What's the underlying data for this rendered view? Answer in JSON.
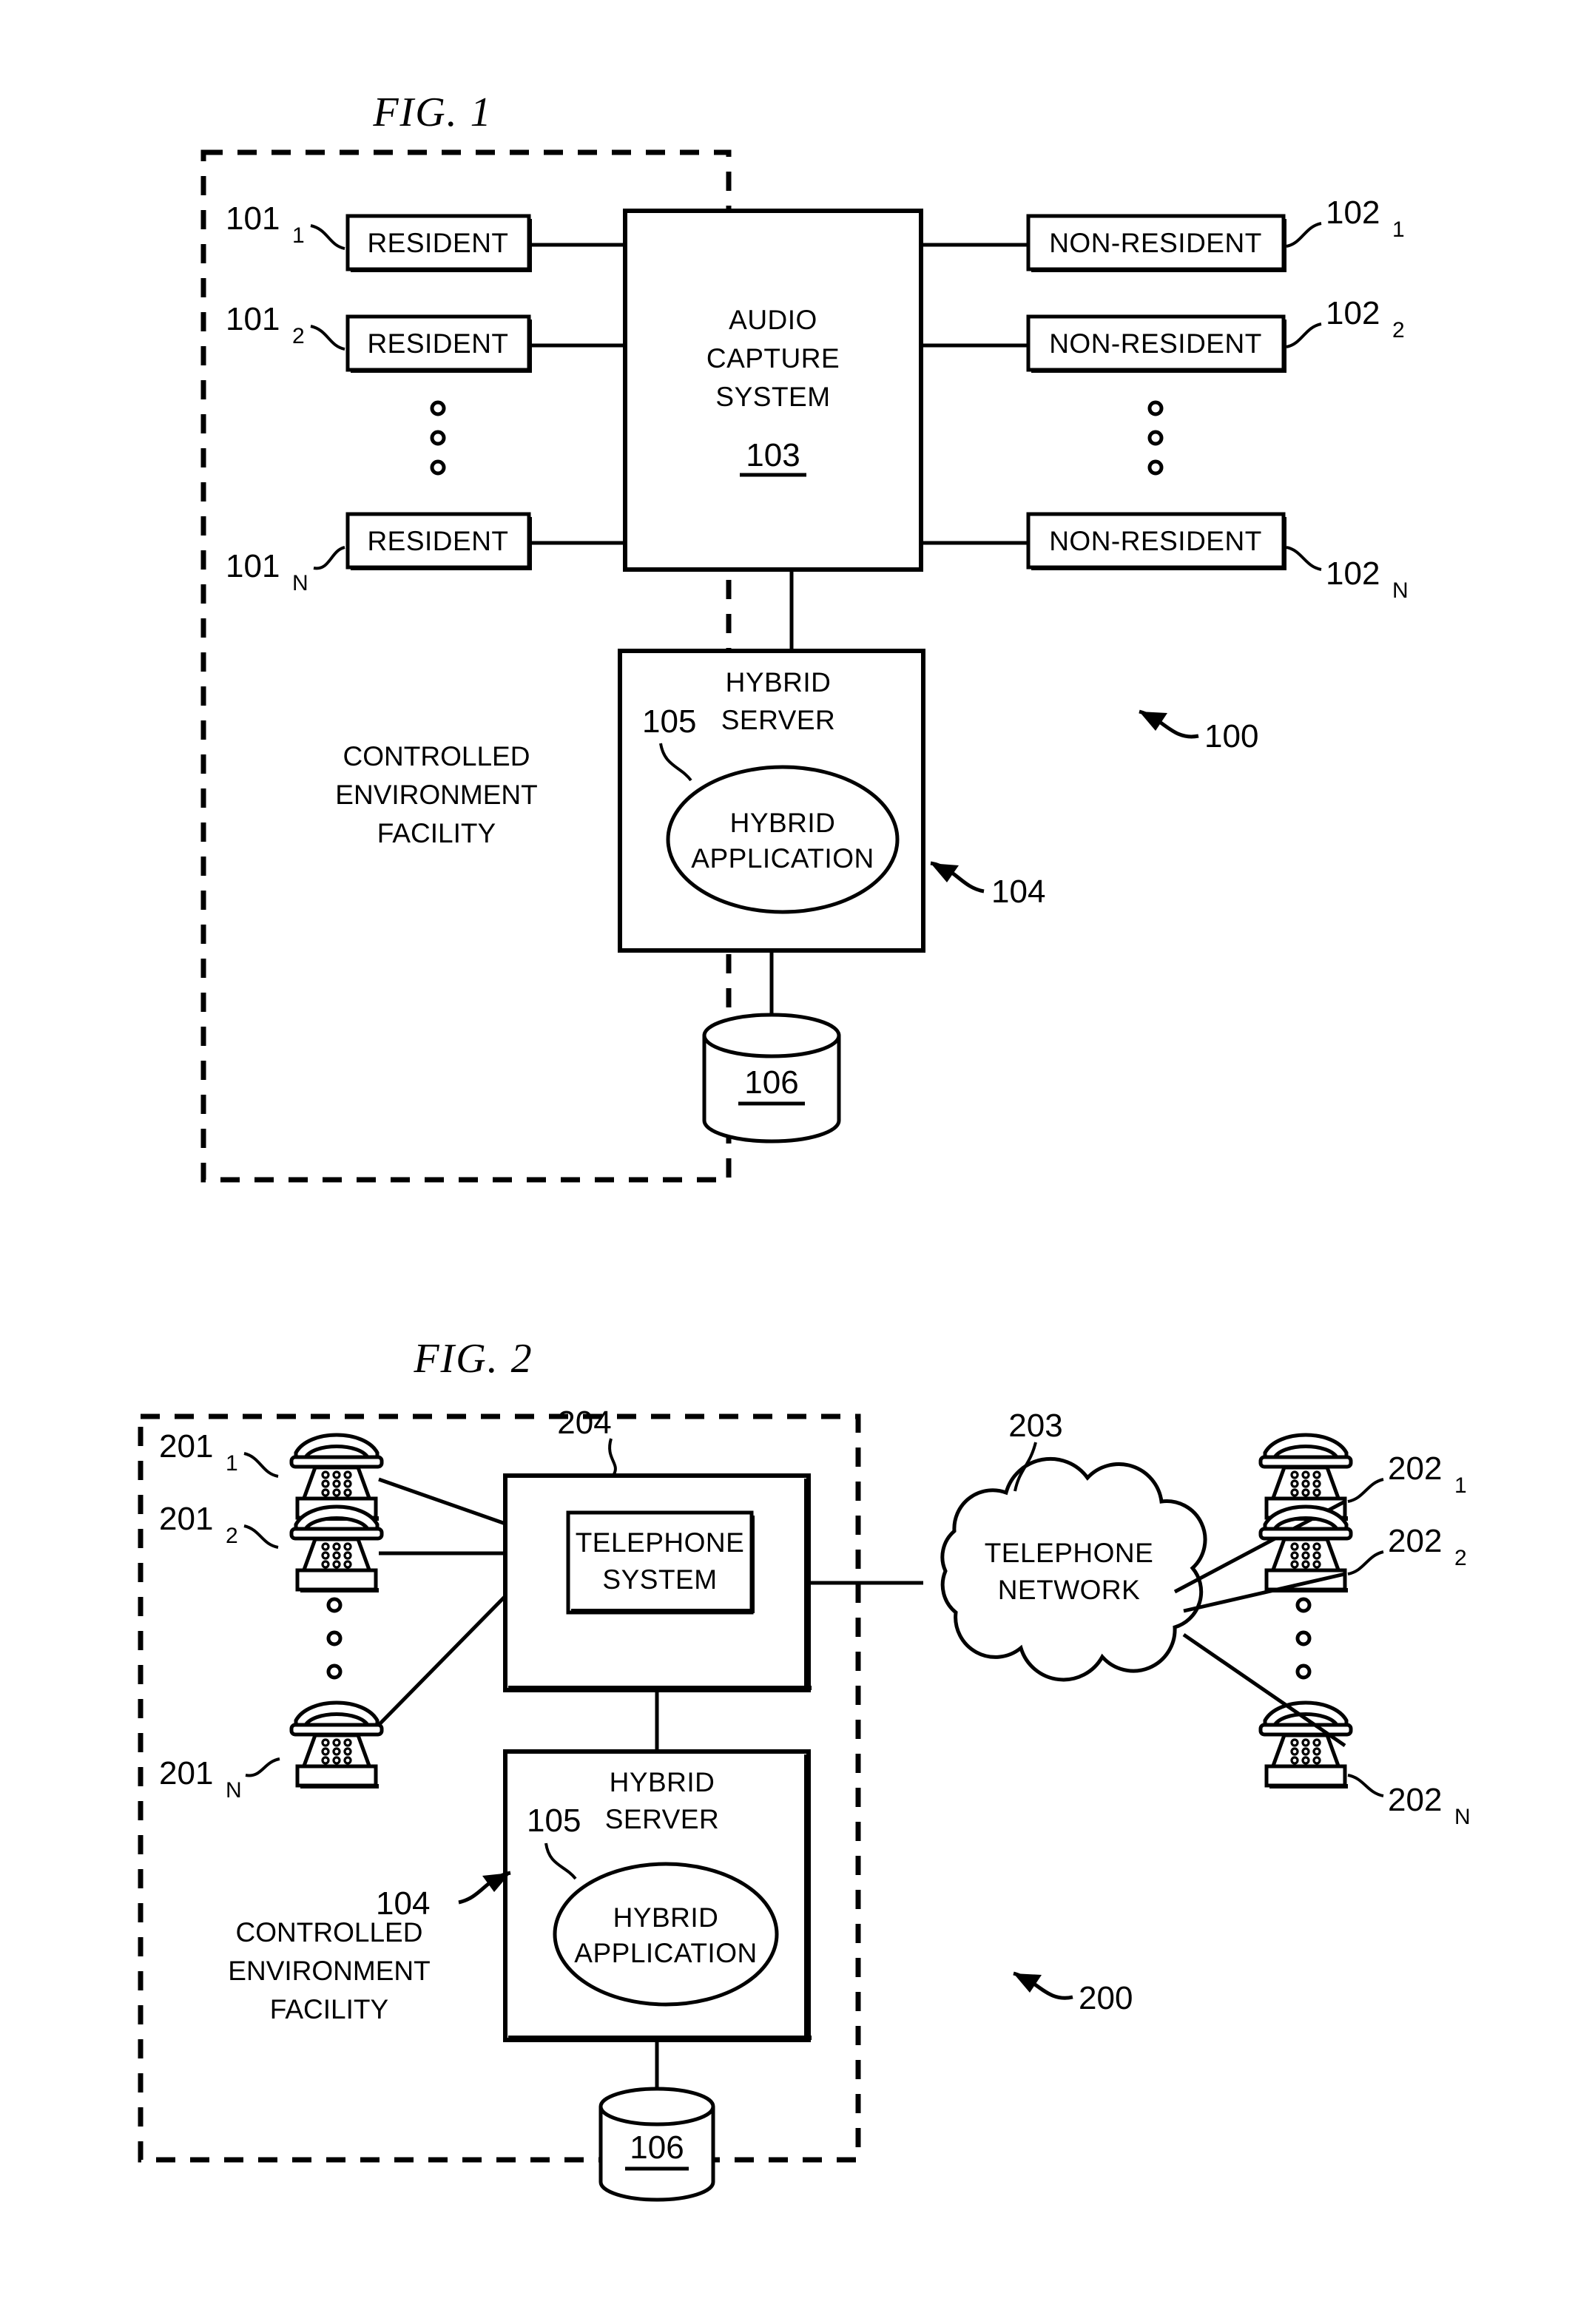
{
  "figures": [
    {
      "id": "fig1",
      "title": "FIG. 1",
      "system_ref": "100",
      "facility_label_lines": [
        "CONTROLLED",
        "ENVIRONMENT",
        "FACILITY"
      ],
      "left_nodes": [
        {
          "label": "RESIDENT",
          "ref": "101",
          "sub": "1"
        },
        {
          "label": "RESIDENT",
          "ref": "101",
          "sub": "2"
        },
        {
          "label": "RESIDENT",
          "ref": "101",
          "sub": "N"
        }
      ],
      "right_nodes": [
        {
          "label": "NON-RESIDENT",
          "ref": "102",
          "sub": "1"
        },
        {
          "label": "NON-RESIDENT",
          "ref": "102",
          "sub": "2"
        },
        {
          "label": "NON-RESIDENT",
          "ref": "102",
          "sub": "N"
        }
      ],
      "center_box": {
        "lines": [
          "AUDIO",
          "CAPTURE",
          "SYSTEM"
        ],
        "ref": "103"
      },
      "server_box": {
        "lines": [
          "HYBRID",
          "SERVER"
        ],
        "ref": "104"
      },
      "application": {
        "lines": [
          "HYBRID",
          "APPLICATION"
        ],
        "ref": "105"
      },
      "database": {
        "ref": "106"
      },
      "ellipsis_symbol": "o"
    },
    {
      "id": "fig2",
      "title": "FIG. 2",
      "system_ref": "200",
      "facility_label_lines": [
        "CONTROLLED",
        "ENVIRONMENT",
        "FACILITY"
      ],
      "left_nodes": [
        {
          "label": "telephone-icon",
          "ref": "201",
          "sub": "1"
        },
        {
          "label": "telephone-icon",
          "ref": "201",
          "sub": "2"
        },
        {
          "label": "telephone-icon",
          "ref": "201",
          "sub": "N"
        }
      ],
      "right_nodes": [
        {
          "label": "telephone-icon",
          "ref": "202",
          "sub": "1"
        },
        {
          "label": "telephone-icon",
          "ref": "202",
          "sub": "2"
        },
        {
          "label": "telephone-icon",
          "ref": "202",
          "sub": "N"
        }
      ],
      "system_box": {
        "lines": [
          "TELEPHONE",
          "SYSTEM"
        ],
        "ref": "204"
      },
      "network_cloud": {
        "lines": [
          "TELEPHONE",
          "NETWORK"
        ],
        "ref": "203"
      },
      "server_box": {
        "lines": [
          "HYBRID",
          "SERVER"
        ],
        "ref": "104"
      },
      "application": {
        "lines": [
          "HYBRID",
          "APPLICATION"
        ],
        "ref": "105"
      },
      "database": {
        "ref": "106"
      },
      "ellipsis_symbol": "o"
    }
  ],
  "colors": {
    "ink": "#000000",
    "paper": "#ffffff"
  }
}
